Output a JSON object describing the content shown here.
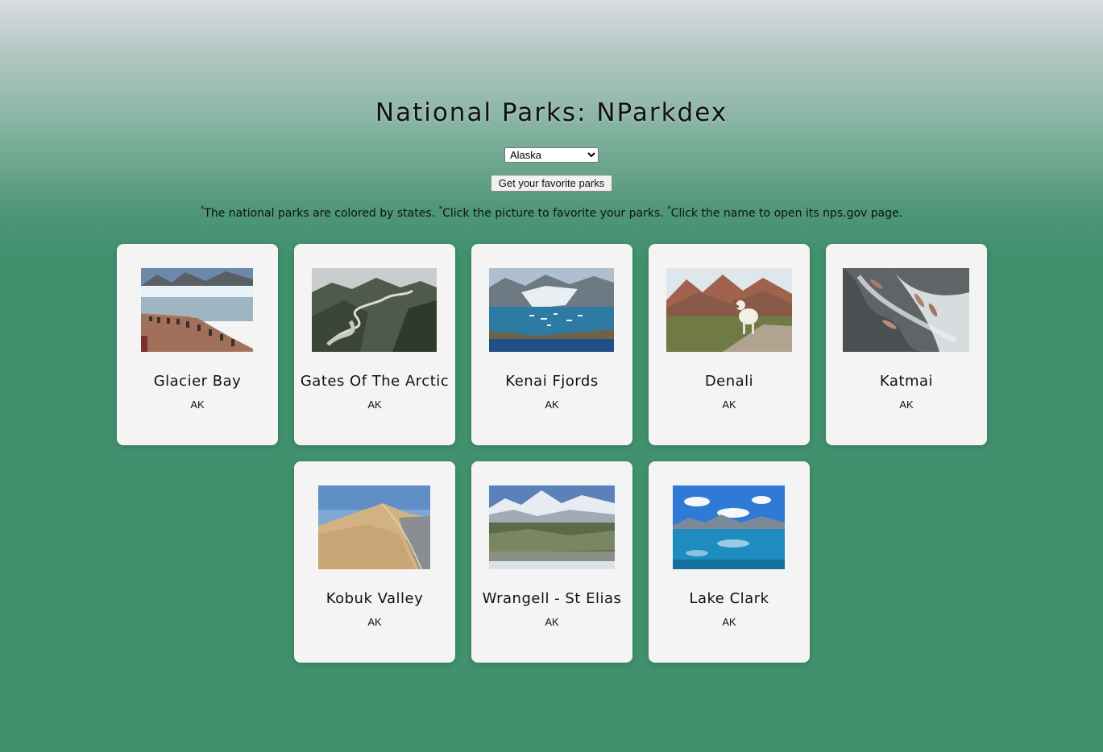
{
  "header": {
    "title": "National Parks: NParkdex"
  },
  "state_select": {
    "value": "Alaska",
    "options": [
      "Alaska"
    ]
  },
  "favorite_button": {
    "label": "Get your favorite parks"
  },
  "notes": [
    "The national parks are colored by states.",
    "Click the picture to favorite your parks.",
    "Click the name to open its nps.gov page."
  ],
  "notes_marker": "*",
  "parks": [
    {
      "name": "Glacier Bay",
      "state": "AK",
      "image": "glacier-bay-photo"
    },
    {
      "name": "Gates Of The Arctic",
      "state": "AK",
      "image": "gates-of-the-arctic-photo"
    },
    {
      "name": "Kenai Fjords",
      "state": "AK",
      "image": "kenai-fjords-photo"
    },
    {
      "name": "Denali",
      "state": "AK",
      "image": "denali-photo"
    },
    {
      "name": "Katmai",
      "state": "AK",
      "image": "katmai-photo"
    },
    {
      "name": "Kobuk Valley",
      "state": "AK",
      "image": "kobuk-valley-photo"
    },
    {
      "name": "Wrangell - St Elias",
      "state": "AK",
      "image": "wrangell-st-elias-photo"
    },
    {
      "name": "Lake Clark",
      "state": "AK",
      "image": "lake-clark-photo"
    }
  ],
  "colors": {
    "background_top": "#dcdce4",
    "background_main": "#41916f",
    "card": "#f4f4f4"
  }
}
